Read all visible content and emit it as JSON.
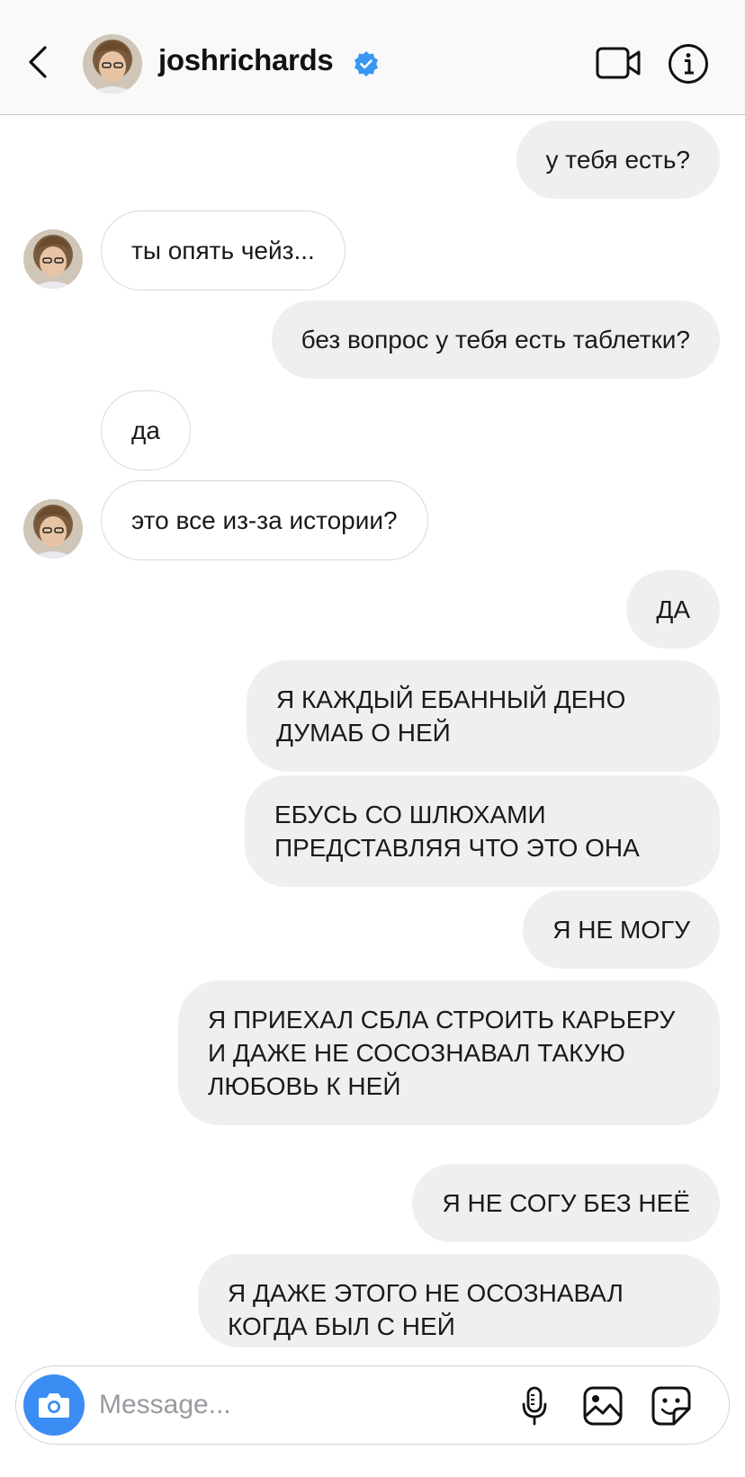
{
  "header": {
    "username": "joshrichards",
    "verified": true
  },
  "messages": [
    {
      "side": "out",
      "text": "у тебя есть?"
    },
    {
      "side": "in",
      "text": "ты опять чейз..."
    },
    {
      "side": "out",
      "text": "без вопрос у тебя есть таблетки?"
    },
    {
      "side": "in",
      "text": "да"
    },
    {
      "side": "in",
      "text": "это все из-за истории?"
    },
    {
      "side": "out",
      "text": "ДА"
    },
    {
      "side": "out",
      "text": "Я КАЖДЫЙ ЕБАННЫЙ ДЕНО ДУМАБ О НЕЙ"
    },
    {
      "side": "out",
      "text": "ЕБУСЬ СО ШЛЮХАМИ ПРЕДСТАВЛЯЯ ЧТО ЭТО ОНА"
    },
    {
      "side": "out",
      "text": "Я НЕ МОГУ"
    },
    {
      "side": "out",
      "text": "Я ПРИЕХАЛ СБЛА СТРОИТЬ КАРЬЕРУ И ДАЖЕ НЕ СОСОЗНАВАЛ ТАКУЮ ЛЮБОВЬ К НЕЙ"
    },
    {
      "side": "out",
      "text": "Я НЕ СОГУ БЕЗ НЕЁ"
    },
    {
      "side": "out",
      "text": "Я ДАЖЕ ЭТОГО НЕ ОСОЗНАВАЛ КОГДА БЫЛ С НЕЙ"
    }
  ],
  "composer": {
    "placeholder": "Message..."
  },
  "icons": {
    "back": "chevron-left-icon",
    "verified": "verified-badge-icon",
    "video": "video-camera-icon",
    "info": "info-icon",
    "camera": "camera-icon",
    "mic": "microphone-icon",
    "gallery": "image-icon",
    "sticker": "sticker-icon"
  },
  "colors": {
    "accent": "#3b8cf3",
    "outgoing_bubble": "#efeff1",
    "incoming_border": "#d9d9dc"
  }
}
